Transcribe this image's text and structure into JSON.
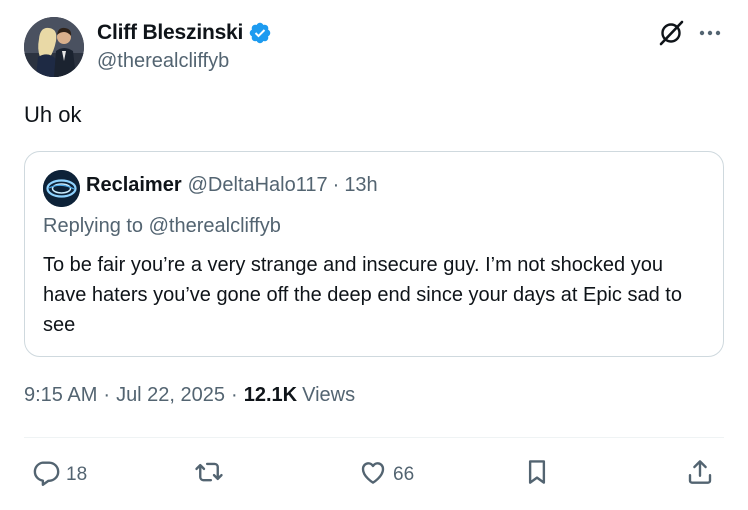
{
  "author": {
    "display_name": "Cliff Bleszinski",
    "handle": "@therealcliffyb",
    "verified_color": "#1d9bf0"
  },
  "header_icons": {
    "grok": "grok-icon",
    "more": "more-horizontal-icon"
  },
  "tweet": {
    "text": "Uh ok"
  },
  "quote": {
    "display_name": "Reclaimer",
    "handle": "@DeltaHalo117",
    "separator": "·",
    "time": "13h",
    "replying_prefix": "Replying to",
    "replying_handle": "@therealcliffyb",
    "text": "To be fair you’re a very strange and insecure guy. I’m not shocked you have haters you’ve gone off the deep end since your days at Epic sad to see"
  },
  "meta": {
    "time": "9:15 AM",
    "date": "Jul 22, 2025",
    "separator": "·",
    "views_count": "12.1K",
    "views_label": "Views"
  },
  "actions": {
    "replies": "18",
    "retweets": "",
    "likes": "66",
    "bookmarks": "",
    "icons": [
      "reply-icon",
      "retweet-icon",
      "like-icon",
      "bookmark-icon",
      "share-icon"
    ]
  },
  "colors": {
    "text": "#0f1419",
    "secondary": "#536471",
    "border": "#cfd9de"
  }
}
